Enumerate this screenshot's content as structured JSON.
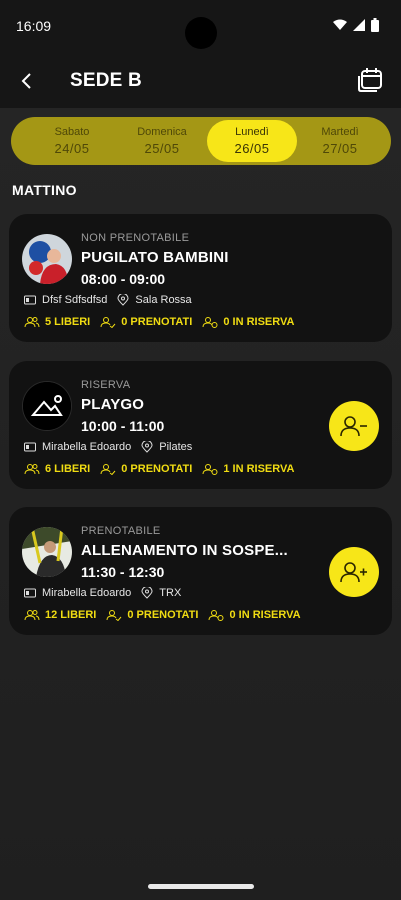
{
  "status_bar": {
    "time": "16:09"
  },
  "header": {
    "title": "SEDE B"
  },
  "dates": [
    {
      "day": "Sabato",
      "date": "24/05",
      "active": false
    },
    {
      "day": "Domenica",
      "date": "25/05",
      "active": false
    },
    {
      "day": "Lunedì",
      "date": "26/05",
      "active": true
    },
    {
      "day": "Martedì",
      "date": "27/05",
      "active": false
    }
  ],
  "section": {
    "title": "MATTINO"
  },
  "classes": [
    {
      "status": "NON PRENOTABILE",
      "title": "PUGILATO BAMBINI",
      "time": "08:00 - 09:00",
      "instructor": "Dfsf Sdfsdfsd",
      "room": "Sala Rossa",
      "free": "5 LIBERI",
      "booked": "0 PRENOTATI",
      "reserve": "0 IN RISERVA",
      "action": "none"
    },
    {
      "status": "RISERVA",
      "title": "PLAYGO",
      "time": "10:00 - 11:00",
      "instructor": "Mirabella Edoardo",
      "room": "Pilates",
      "free": "6 LIBERI",
      "booked": "0 PRENOTATI",
      "reserve": "1 IN RISERVA",
      "action": "remove"
    },
    {
      "status": "PRENOTABILE",
      "title": "ALLENAMENTO IN SOSPE...",
      "time": "11:30 - 12:30",
      "instructor": "Mirabella Edoardo",
      "room": "TRX",
      "free": "12 LIBERI",
      "booked": "0 PRENOTATI",
      "reserve": "0 IN RISERVA",
      "action": "add"
    }
  ],
  "colors": {
    "accent": "#f7e618",
    "accent_dark": "#a49715",
    "card": "#121212"
  }
}
